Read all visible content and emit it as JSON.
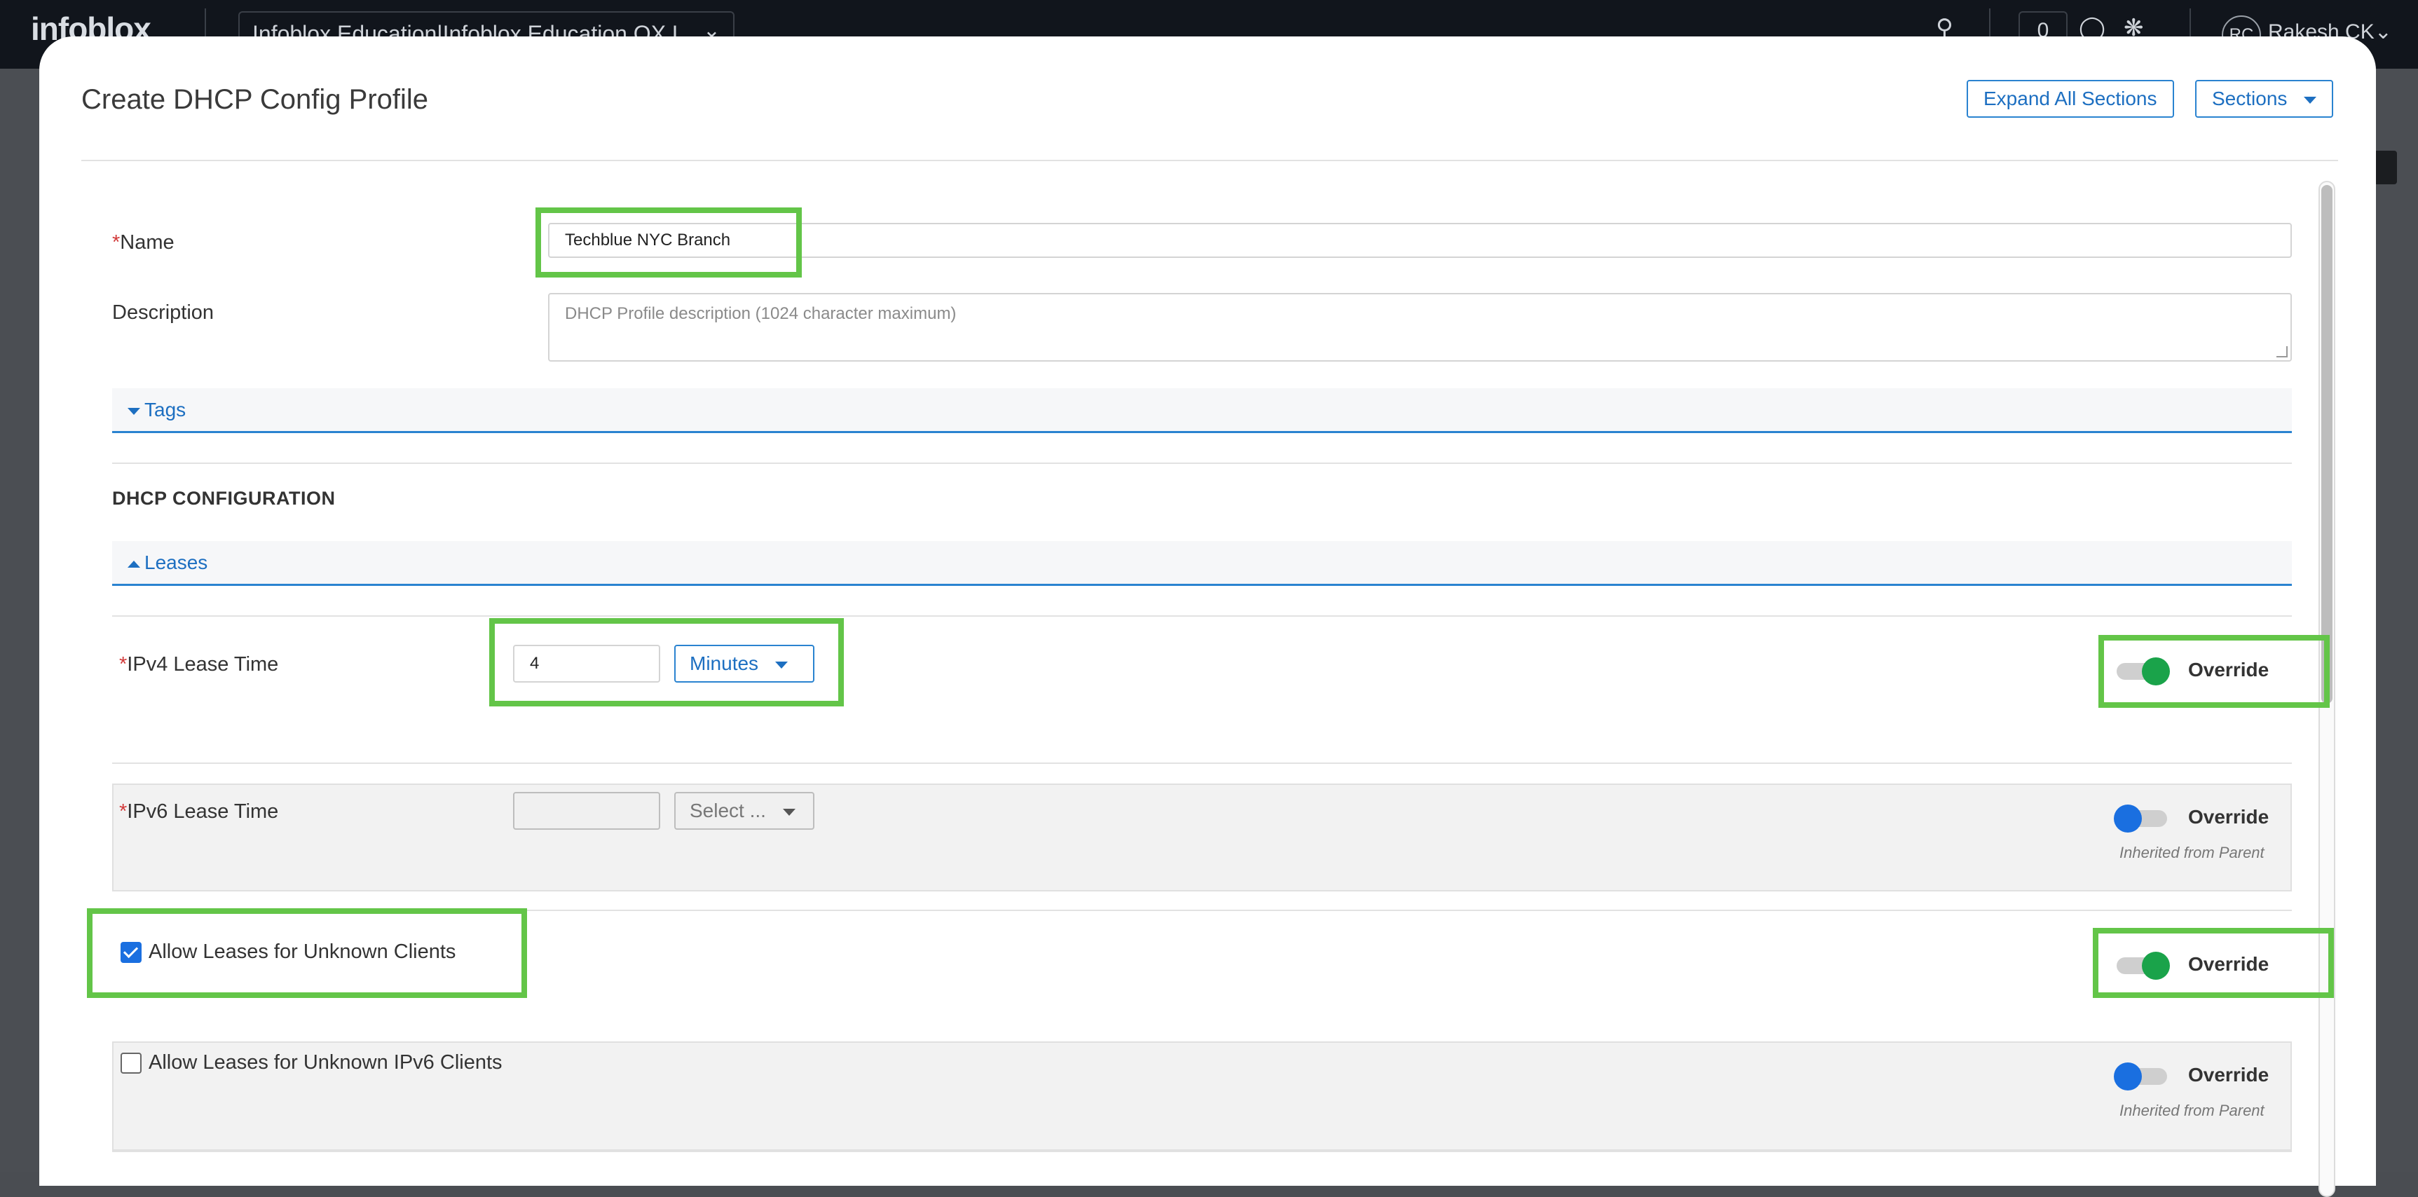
{
  "app": {
    "logo": "infoblox",
    "org_selector": "Infoblox Education|Infoblox Education OX L",
    "notification_count": "0",
    "user_initials": "RC",
    "user_name": "Rakesh CK"
  },
  "modal": {
    "title": "Create DHCP Config Profile",
    "expand_all_label": "Expand All Sections",
    "sections_label": "Sections"
  },
  "form": {
    "name": {
      "label": "Name",
      "value": "Techblue NYC Branch"
    },
    "description": {
      "label": "Description",
      "placeholder": "DHCP Profile description (1024 character maximum)"
    },
    "tags_label": "Tags"
  },
  "dhcp": {
    "section_title": "DHCP CONFIGURATION",
    "leases_label": "Leases",
    "ipv4_lease": {
      "label": "IPv4 Lease Time",
      "value": "4",
      "unit": "Minutes",
      "override_label": "Override",
      "override": true
    },
    "ipv6_lease": {
      "label": "IPv6 Lease Time",
      "value": "",
      "unit": "Select ...",
      "override_label": "Override",
      "override": false,
      "inherited": "Inherited from Parent"
    },
    "unknown_clients": {
      "label": "Allow Leases for Unknown Clients",
      "checked": true,
      "override_label": "Override",
      "override": true
    },
    "unknown_ipv6_clients": {
      "label": "Allow Leases for Unknown IPv6 Clients",
      "checked": false,
      "override_label": "Override",
      "override": false,
      "inherited": "Inherited from Parent"
    }
  },
  "colors": {
    "accent_blue": "#1d6fc1",
    "toggle_on": "#1aa34a",
    "toggle_off_knob": "#1a6fe0",
    "highlight_green": "#63c548",
    "required_red": "#d23b3b"
  },
  "icons": [
    "search-icon",
    "shield-icon",
    "settings-icon",
    "chevron-down-icon",
    "caret-down-icon",
    "caret-up-icon",
    "check-icon"
  ]
}
